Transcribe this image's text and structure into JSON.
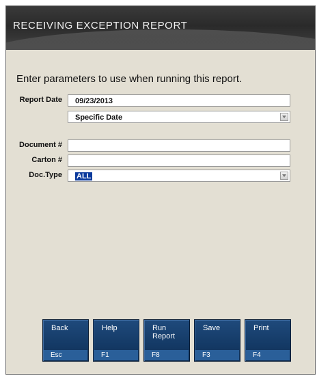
{
  "window": {
    "title": "RECEIVING EXCEPTION REPORT"
  },
  "instructions": "Enter parameters to use when running this report.",
  "form": {
    "report_date": {
      "label": "Report Date",
      "value": "09/23/2013",
      "mode": "Specific Date"
    },
    "document": {
      "label": "Document #",
      "value": ""
    },
    "carton": {
      "label": "Carton #",
      "value": ""
    },
    "doc_type": {
      "label": "Doc.Type",
      "value": "ALL"
    }
  },
  "buttons": [
    {
      "label": "Back",
      "key": "Esc"
    },
    {
      "label": "Help",
      "key": "F1"
    },
    {
      "label": "Run Report",
      "key": "F8"
    },
    {
      "label": "Save",
      "key": "F3"
    },
    {
      "label": "Print",
      "key": "F4"
    }
  ],
  "colors": {
    "background": "#e3dfd3",
    "titlebar": "#2a2a2a",
    "button": "#143a66",
    "button_key_strip": "#2a5f99",
    "selection": "#0b3a9c"
  }
}
